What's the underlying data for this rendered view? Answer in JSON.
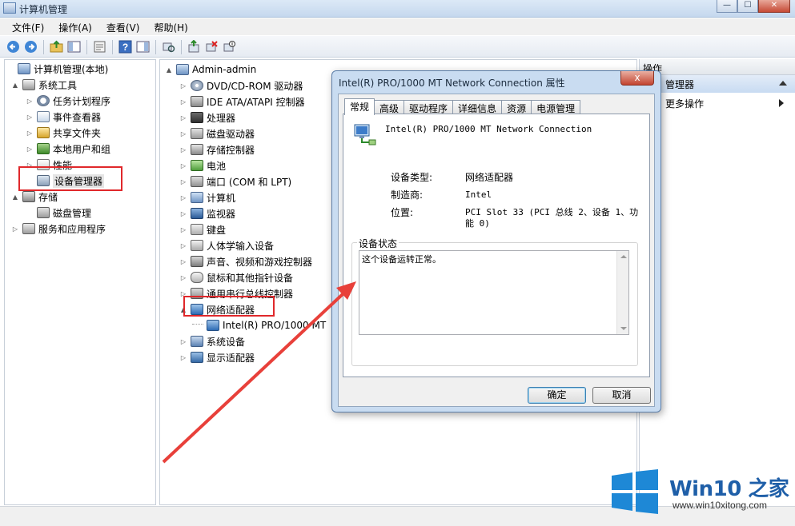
{
  "window": {
    "title": "计算机管理"
  },
  "menu": [
    "文件(F)",
    "操作(A)",
    "查看(V)",
    "帮助(H)"
  ],
  "left_tree": [
    {
      "label": "计算机管理(本地)",
      "icon": "computer",
      "expander": ""
    },
    {
      "label": "系统工具",
      "icon": "tools",
      "expander": "▲"
    },
    {
      "label": "任务计划程序",
      "icon": "clock",
      "expander": "▷"
    },
    {
      "label": "事件查看器",
      "icon": "log",
      "expander": "▷"
    },
    {
      "label": "共享文件夹",
      "icon": "share",
      "expander": "▷"
    },
    {
      "label": "本地用户和组",
      "icon": "users",
      "expander": "▷"
    },
    {
      "label": "性能",
      "icon": "perf",
      "expander": "▷"
    },
    {
      "label": "设备管理器",
      "icon": "devmgr",
      "expander": ""
    },
    {
      "label": "存储",
      "icon": "storage",
      "expander": "▲"
    },
    {
      "label": "磁盘管理",
      "icon": "disk",
      "expander": ""
    },
    {
      "label": "服务和应用程序",
      "icon": "services",
      "expander": "▷"
    }
  ],
  "device_tree": {
    "root": "Admin-admin",
    "categories": [
      {
        "label": "DVD/CD-ROM 驱动器",
        "icon": "dvd"
      },
      {
        "label": "IDE ATA/ATAPI 控制器",
        "icon": "ide"
      },
      {
        "label": "处理器",
        "icon": "cpu"
      },
      {
        "label": "磁盘驱动器",
        "icon": "disk"
      },
      {
        "label": "存储控制器",
        "icon": "storage"
      },
      {
        "label": "电池",
        "icon": "battery"
      },
      {
        "label": "端口 (COM 和 LPT)",
        "icon": "port"
      },
      {
        "label": "计算机",
        "icon": "computer"
      },
      {
        "label": "监视器",
        "icon": "monitor"
      },
      {
        "label": "键盘",
        "icon": "keyboard"
      },
      {
        "label": "人体学输入设备",
        "icon": "hid"
      },
      {
        "label": "声音、视频和游戏控制器",
        "icon": "sound"
      },
      {
        "label": "鼠标和其他指针设备",
        "icon": "mouse"
      },
      {
        "label": "通用串行总线控制器",
        "icon": "usb"
      },
      {
        "label": "网络适配器",
        "icon": "net"
      },
      {
        "label": "Intel(R) PRO/1000 MT",
        "icon": "net",
        "child": true
      },
      {
        "label": "系统设备",
        "icon": "system"
      },
      {
        "label": "显示适配器",
        "icon": "display"
      }
    ]
  },
  "actions": {
    "header": "操作",
    "section": "管理器",
    "more": "更多操作"
  },
  "dialog": {
    "title": "Intel(R) PRO/1000 MT Network Connection 属性",
    "close_label": "x",
    "tabs": [
      "常规",
      "高级",
      "驱动程序",
      "详细信息",
      "资源",
      "电源管理"
    ],
    "active_tab": 0,
    "device_name": "Intel(R) PRO/1000 MT Network Connection",
    "props": {
      "type_label": "设备类型:",
      "type_value": "网络适配器",
      "maker_label": "制造商:",
      "maker_value": "Intel",
      "loc_label": "位置:",
      "loc_value_line1": "PCI Slot 33 (PCI 总线 2、设备 1、功",
      "loc_value_line2": "能 0)"
    },
    "status_legend": "设备状态",
    "status_text": "这个设备运转正常。",
    "ok": "确定",
    "cancel": "取消"
  },
  "watermark": {
    "brand": "Win10 之家",
    "url": "www.win10xitong.com"
  },
  "colors": {
    "highlight_red": "#e0282b",
    "arrow_red": "#e8403a",
    "brand_blue": "#1f5fa8"
  }
}
